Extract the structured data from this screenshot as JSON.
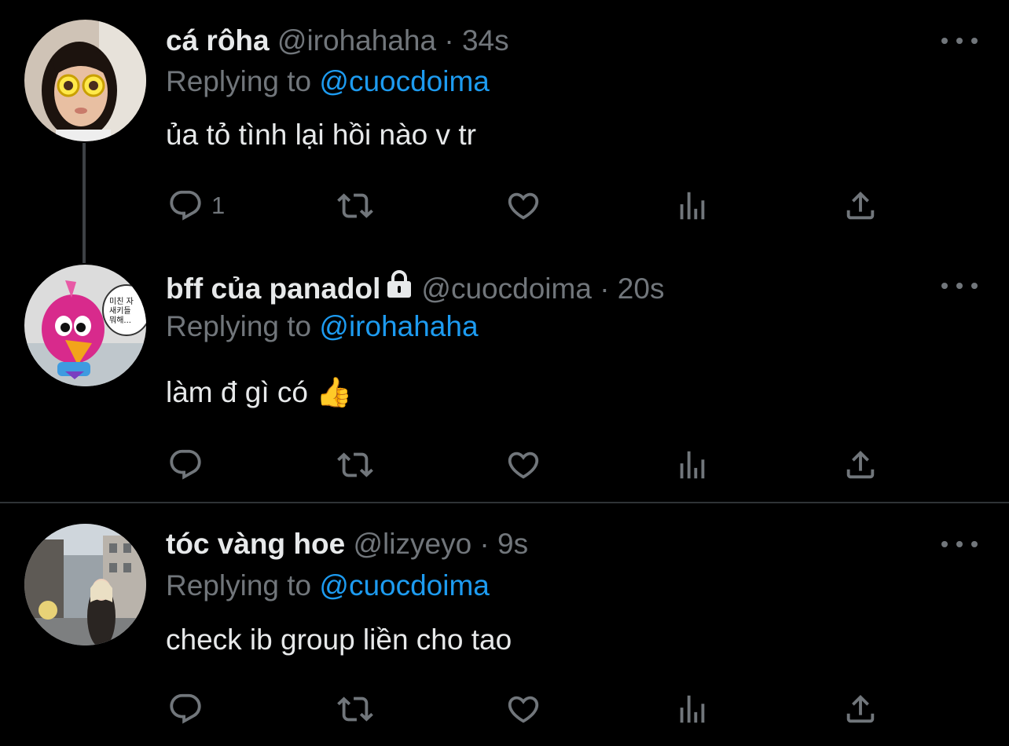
{
  "tweets": [
    {
      "name": "cá rôha",
      "handle": "@irohahaha",
      "dot": "·",
      "time": "34s",
      "reply_prefix": "Replying to",
      "reply_to": "@cuocdoima",
      "text": "ủa tỏ tình lại hồi nào v tr",
      "reply_count": "1",
      "protected": false
    },
    {
      "name": "bff của panadol",
      "handle": "@cuocdoima",
      "dot": "·",
      "time": "20s",
      "reply_prefix": "Replying to",
      "reply_to": "@irohahaha",
      "text": "làm đ gì có 👍",
      "reply_count": "",
      "protected": true,
      "avatar_speech": "미친 자\n새키들\n뭐해..."
    },
    {
      "name": "tóc vàng hoe",
      "handle": "@lizyeyo",
      "dot": "·",
      "time": "9s",
      "reply_prefix": "Replying to",
      "reply_to": "@cuocdoima",
      "text": "check ib group liền cho tao",
      "reply_count": "",
      "protected": false
    }
  ],
  "icons": [
    "reply-icon",
    "retweet-icon",
    "like-icon",
    "analytics-icon",
    "share-icon",
    "more-icon",
    "lock-icon"
  ],
  "colors": {
    "background": "#000000",
    "text": "#e7e9ea",
    "muted": "#71767b",
    "link": "#1d9bf0",
    "divider": "#2f3336"
  }
}
